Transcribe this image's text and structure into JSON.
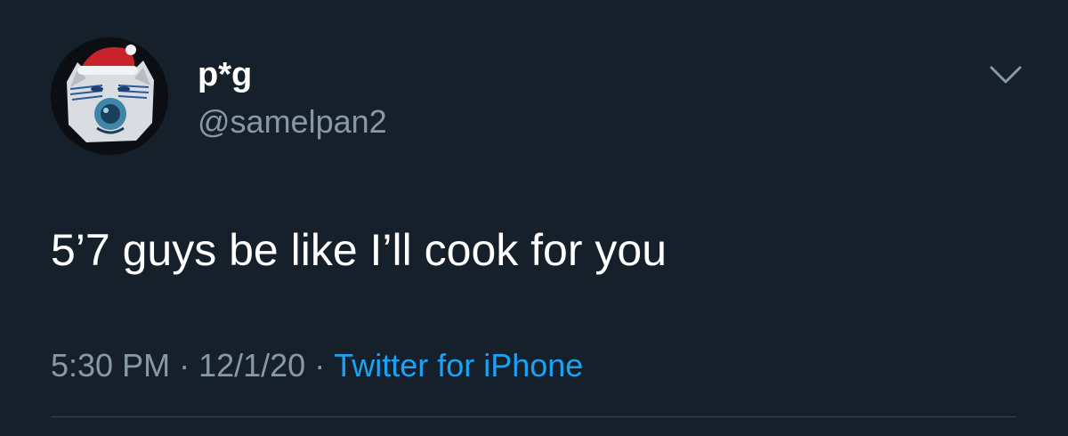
{
  "author": {
    "display_name": "p*g",
    "handle": "@samelpan2",
    "avatar_icon": "cat-face-santa-hat-avatar"
  },
  "tweet": {
    "text": "5’7 guys be like I’ll cook for you",
    "time": "5:30 PM",
    "separator": "·",
    "date": "12/1/20",
    "source": "Twitter for iPhone"
  },
  "menu_icon": "chevron-down-icon",
  "colors": {
    "background": "#15202b",
    "primary_text": "#ffffff",
    "secondary_text": "#8899a6",
    "link": "#1da1f2",
    "divider": "#38444d"
  }
}
